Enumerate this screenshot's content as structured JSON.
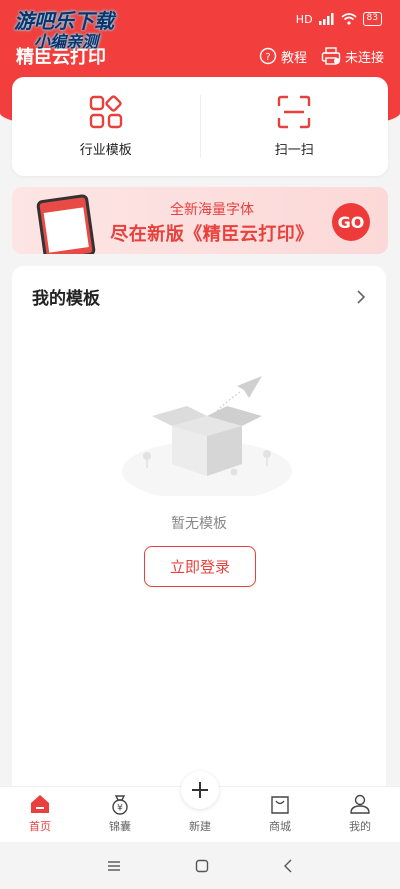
{
  "status_bar": {
    "network": "HD",
    "battery": "83"
  },
  "watermark": {
    "line1": "游吧乐下载",
    "line2": "小编亲测"
  },
  "header": {
    "app_title": "精臣云打印",
    "tutorial_label": "教程",
    "connection_label": "未连接"
  },
  "quick_actions": [
    {
      "label": "行业模板",
      "icon": "template-grid-icon"
    },
    {
      "label": "扫一扫",
      "icon": "scan-icon"
    }
  ],
  "banner": {
    "line1": "全新海量字体",
    "line2": "尽在新版《精臣云打印》",
    "go_label": "GO"
  },
  "templates": {
    "title": "我的模板",
    "empty_text": "暂无模板",
    "login_label": "立即登录"
  },
  "tabbar": {
    "items": [
      {
        "label": "首页",
        "icon": "home-icon",
        "active": true
      },
      {
        "label": "锦囊",
        "icon": "money-bag-icon",
        "active": false
      },
      {
        "label": "新建",
        "icon": "plus-icon",
        "active": false
      },
      {
        "label": "商城",
        "icon": "shop-bag-icon",
        "active": false
      },
      {
        "label": "我的",
        "icon": "profile-icon",
        "active": false
      }
    ]
  },
  "colors": {
    "brand_red": "#f23e3c",
    "text_red": "#e8413d"
  }
}
